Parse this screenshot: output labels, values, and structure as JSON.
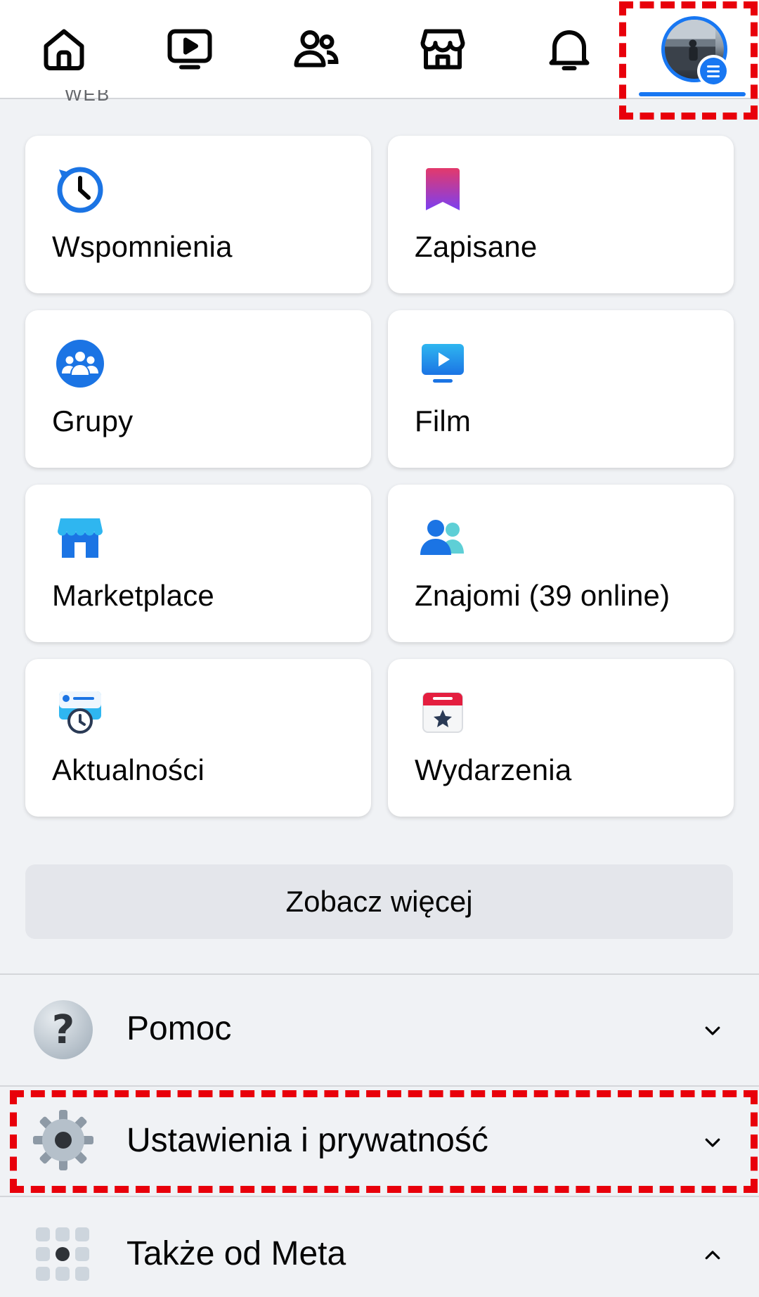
{
  "nav": {
    "tabs": [
      {
        "name": "home",
        "icon": "home-icon"
      },
      {
        "name": "video",
        "icon": "video-icon"
      },
      {
        "name": "friends",
        "icon": "friends-icon"
      },
      {
        "name": "marketplace",
        "icon": "store-icon"
      },
      {
        "name": "notifications",
        "icon": "bell-icon"
      },
      {
        "name": "menu",
        "icon": "avatar-menu-icon",
        "active": true
      }
    ],
    "peek_text": "WEB"
  },
  "shortcuts": [
    {
      "label": "Wspomnienia",
      "icon": "memories-clock-icon"
    },
    {
      "label": "Zapisane",
      "icon": "saved-bookmark-icon"
    },
    {
      "label": "Grupy",
      "icon": "groups-icon"
    },
    {
      "label": "Film",
      "icon": "video-tv-icon"
    },
    {
      "label": "Marketplace",
      "icon": "marketplace-store-icon"
    },
    {
      "label": "Znajomi (39 online)",
      "icon": "friends-icon"
    },
    {
      "label": "Aktualności",
      "icon": "feeds-icon"
    },
    {
      "label": "Wydarzenia",
      "icon": "events-calendar-icon"
    }
  ],
  "see_more_label": "Zobacz więcej",
  "sections": [
    {
      "label": "Pomoc",
      "icon": "help-question-icon",
      "expanded": false
    },
    {
      "label": "Ustawienia i prywatność",
      "icon": "settings-gear-icon",
      "expanded": false
    },
    {
      "label": "Także od Meta",
      "icon": "meta-apps-grid-icon",
      "expanded": true
    }
  ],
  "colors": {
    "accent": "#1877f2",
    "highlight": "#e8000b",
    "background": "#f0f2f5"
  }
}
